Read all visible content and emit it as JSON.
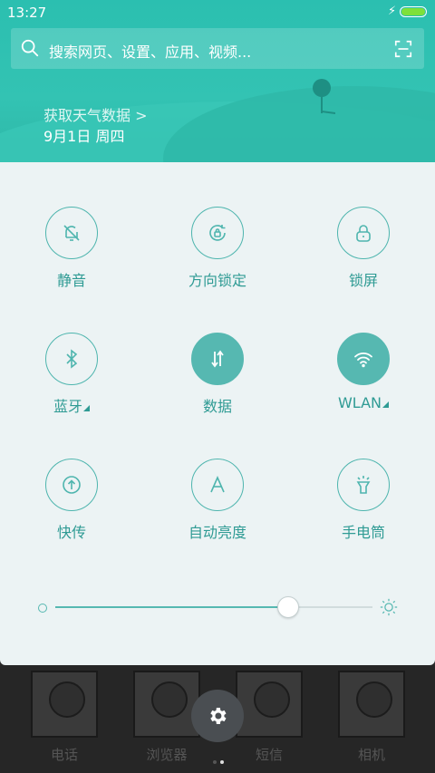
{
  "status_bar": {
    "time": "13:27",
    "battery_color": "#7ee03a"
  },
  "search": {
    "placeholder": "搜索网页、设置、应用、视频..."
  },
  "weather": {
    "link_text": "获取天气数据 >",
    "date": "9月1日 周四"
  },
  "tiles": [
    {
      "label": "静音",
      "icon": "bell-off-icon",
      "active": false
    },
    {
      "label": "方向锁定",
      "icon": "rotation-lock-icon",
      "active": false
    },
    {
      "label": "锁屏",
      "icon": "lock-icon",
      "active": false
    },
    {
      "label": "蓝牙",
      "icon": "bluetooth-icon",
      "active": false,
      "has_more": true
    },
    {
      "label": "数据",
      "icon": "data-transfer-icon",
      "active": true
    },
    {
      "label": "WLAN",
      "icon": "wifi-icon",
      "active": true,
      "has_more": true
    },
    {
      "label": "快传",
      "icon": "send-icon",
      "active": false
    },
    {
      "label": "自动亮度",
      "icon": "auto-brightness-icon",
      "active": false
    },
    {
      "label": "手电筒",
      "icon": "flashlight-icon",
      "active": false
    }
  ],
  "brightness": {
    "level": 0.73
  },
  "colors": {
    "accent": "#56b8b1",
    "panel_bg": "#ecf3f4",
    "header_teal": "#33c3b3"
  },
  "dock_apps": [
    {
      "label": "电话"
    },
    {
      "label": "浏览器"
    },
    {
      "label": "短信"
    },
    {
      "label": "相机"
    }
  ]
}
